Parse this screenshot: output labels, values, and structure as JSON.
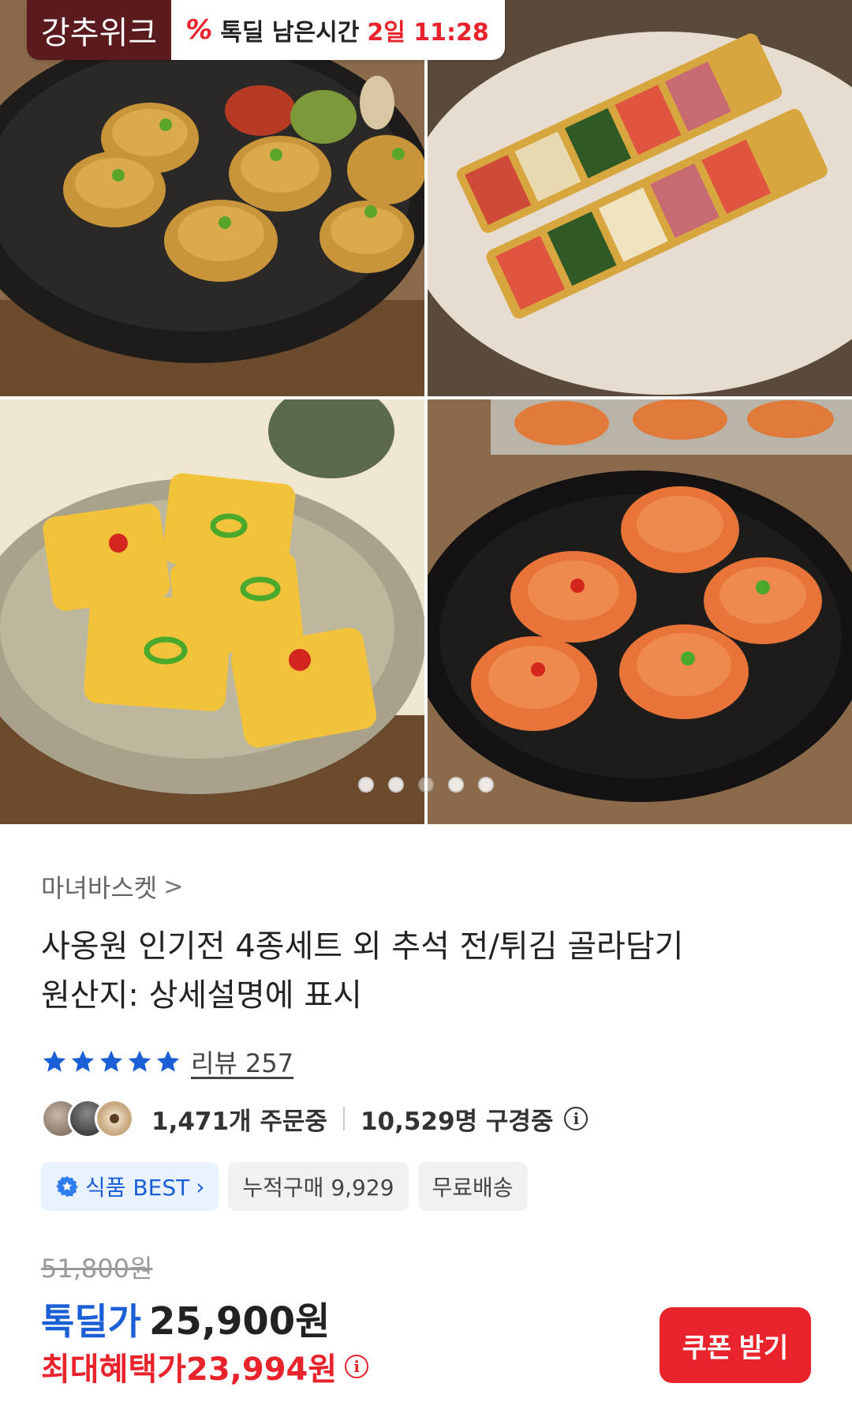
{
  "promo": {
    "brand": "강추위크",
    "timer_prefix": "톡딜 남은시간",
    "time_remaining": "2일 11:28",
    "accent": "#e8232b",
    "brand_color": "#5b1a1d"
  },
  "gallery": {
    "images": [
      {
        "icon": "food-photo-hamburg-jeon"
      },
      {
        "icon": "food-photo-skewer-jeon"
      },
      {
        "icon": "food-photo-fish-jeon"
      },
      {
        "icon": "food-photo-kimchi-jeon"
      }
    ],
    "page_count": 5,
    "current_page": 3
  },
  "product": {
    "store": "마녀바스켓",
    "store_chevron": ">",
    "title_line1": "사옹원 인기전 4종세트 외 추석 전/튀김 골라담기",
    "title_line2": "원산지: 상세설명에 표시",
    "rating_stars": 5,
    "review_label": "리뷰 257",
    "ordering": "1,471개 주문중",
    "browsing": "10,529명 구경중",
    "tags": {
      "best": "식품 BEST",
      "cumulative": "누적구매 9,929",
      "shipping": "무료배송"
    },
    "original_price": "51,800원",
    "deal_label": "톡딜가",
    "deal_price": "25,900원",
    "max_benefit": "최대혜택가23,994원",
    "coupon_button": "쿠폰 받기",
    "colors": {
      "deal_blue": "#1a5fd6",
      "red": "#e8232b",
      "star": "#1a5fd6"
    }
  }
}
